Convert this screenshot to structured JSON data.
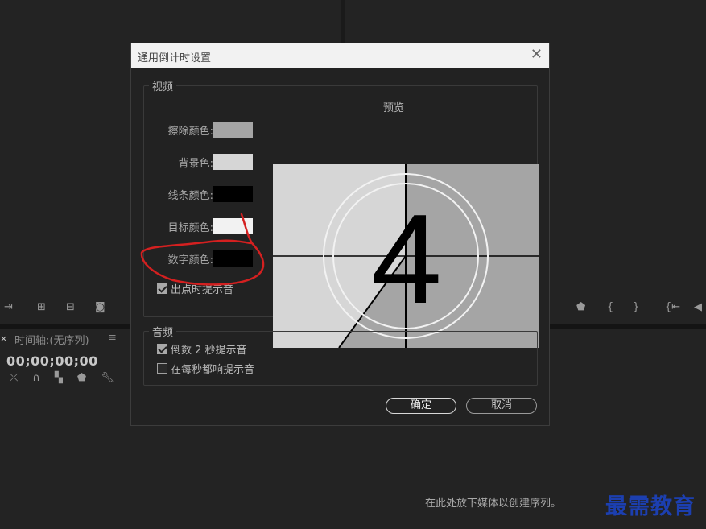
{
  "background": {
    "timeline": {
      "close_glyph": "×",
      "title": "时间轴:(无序列)",
      "menu_glyph": "≡",
      "timecode": "00;00;00;00"
    },
    "drop_hint": "在此处放下媒体以创建序列。",
    "watermark": "最需教育"
  },
  "dialog": {
    "title": "通用倒计时设置",
    "video_group": {
      "legend": "视频",
      "preview_label": "预览",
      "preview_number": "4",
      "colors": [
        {
          "label": "擦除颜色:",
          "color": "#a5a5a5"
        },
        {
          "label": "背景色:",
          "color": "#d6d6d6"
        },
        {
          "label": "线条颜色:",
          "color": "#000000"
        },
        {
          "label": "目标颜色:",
          "color": "#f2f2f2"
        },
        {
          "label": "数字颜色:",
          "color": "#000000"
        }
      ],
      "out_point_cue": {
        "label": "出点时提示音",
        "checked": true
      }
    },
    "audio_group": {
      "legend": "音频",
      "options": [
        {
          "label": "倒数 2 秒提示音",
          "checked": true
        },
        {
          "label": "在每秒都响提示音",
          "checked": false
        }
      ]
    },
    "buttons": {
      "ok": "确定",
      "cancel": "取消"
    }
  },
  "annotation": {
    "color": "#d42020"
  }
}
